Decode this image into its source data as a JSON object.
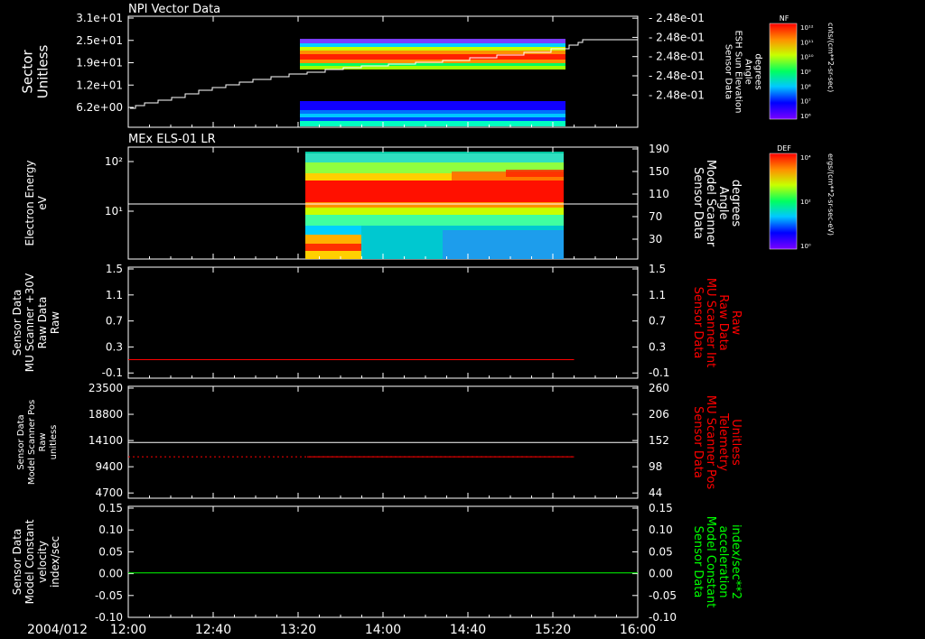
{
  "chart_data": {
    "type": "multi-panel time series",
    "date_label": "2004/012",
    "time_ticks": [
      "12:00",
      "12:40",
      "13:20",
      "14:00",
      "14:40",
      "15:20",
      "16:00"
    ],
    "panels": [
      {
        "title": "NPI Vector Data",
        "kind": "spectrogram+line",
        "left_label": [
          "Sector",
          "Unitless"
        ],
        "left_ticks": [
          "3.1e+01",
          "2.5e+01",
          "1.9e+01",
          "1.2e+01",
          "6.2e+00"
        ],
        "right_label": [
          "Sensor Data",
          "ESH Sun Elevation",
          "Angle",
          "degrees"
        ],
        "right_ticks": [
          "2.48e-01",
          "2.48e-01",
          "2.48e-01",
          "2.48e-01",
          "2.48e-01"
        ],
        "line_color": "#ffffff",
        "colorbar_title": "NF",
        "colorbar_unit": "cnts/(cm**2-sr-sec)",
        "colorbar_ticks": [
          "10¹²",
          "10¹¹",
          "10¹⁰",
          "10⁹",
          "10⁸",
          "10⁷",
          "10⁶"
        ]
      },
      {
        "title": "MEx ELS-01 LR",
        "kind": "spectrogram+line",
        "left_label": [
          "Electron Energy",
          "eV"
        ],
        "left_ticks": [
          "10²",
          "10¹"
        ],
        "right_label": [
          "Sensor Data",
          "Model Scanner",
          "Angle",
          "degrees"
        ],
        "right_ticks": [
          "190",
          "150",
          "110",
          "70",
          "30"
        ],
        "line_color": "#ffffff",
        "colorbar_title": "DEF",
        "colorbar_unit": "ergs/(cm**2-sr-sec-eV)",
        "colorbar_ticks": [
          "10⁴",
          "10²",
          "10⁰"
        ]
      },
      {
        "kind": "line",
        "left_label": [
          "Sensor Data",
          "MU Scanner +30V",
          "Raw Data",
          "Raw"
        ],
        "left_ticks": [
          "1.5",
          "1.1",
          "0.7",
          "0.3",
          "-0.1"
        ],
        "right_label": [
          "Sensor Data",
          "MU Scanner Int",
          "Raw Data",
          "Raw"
        ],
        "right_ticks": [
          "1.5",
          "1.1",
          "0.7",
          "0.3",
          "-0.1"
        ],
        "right_label_color": "#ff0000",
        "line_color": "#ff0000",
        "ylim": [
          -0.3,
          1.5
        ],
        "series": [
          {
            "x": [
              "12:00",
              "15:30"
            ],
            "y": [
              0.0,
              0.0
            ]
          }
        ]
      },
      {
        "kind": "line",
        "left_label": [
          "Sensor Data",
          "Model Scanner Pos",
          "Raw",
          "unitless"
        ],
        "left_ticks": [
          "23500",
          "18800",
          "14100",
          "9400",
          "4700"
        ],
        "right_label": [
          "Sensor Data",
          "MU Scanner Pos",
          "Telemetry",
          "Unitless"
        ],
        "right_ticks": [
          "260",
          "206",
          "152",
          "98",
          "44"
        ],
        "right_label_color": "#ff0000",
        "ylim_left": [
          0,
          23500
        ],
        "ylim_right": [
          -10,
          260
        ],
        "series": [
          {
            "axis": "left",
            "color": "#ffffff",
            "x": [
              "12:00",
              "16:00"
            ],
            "y": [
              11700,
              11700
            ]
          },
          {
            "axis": "right",
            "color": "#ff0000",
            "x": [
              "12:00",
              "15:30"
            ],
            "y": [
              90,
              90
            ]
          }
        ]
      },
      {
        "kind": "line",
        "left_label": [
          "Sensor Data",
          "Model Constant",
          "velocity",
          "index/sec"
        ],
        "left_ticks": [
          "0.15",
          "0.10",
          "0.05",
          "0.00",
          "-0.05",
          "-0.10"
        ],
        "right_label": [
          "Sensor Data",
          "Model Constant",
          "acceleration",
          "index/sec**2"
        ],
        "right_ticks": [
          "0.15",
          "0.10",
          "0.05",
          "0.00",
          "-0.05",
          "-0.10"
        ],
        "right_label_color": "#00ff00",
        "line_color": "#00ff00",
        "ylim": [
          -0.1,
          0.15
        ],
        "series": [
          {
            "x": [
              "12:00",
              "16:00"
            ],
            "y": [
              0.0,
              0.0
            ]
          }
        ]
      }
    ]
  }
}
